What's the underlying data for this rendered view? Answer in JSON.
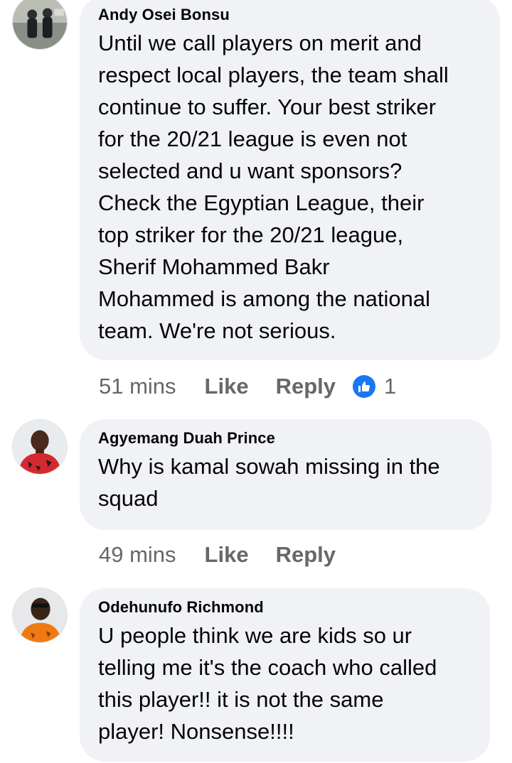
{
  "comments": [
    {
      "author": "Andy Osei Bonsu",
      "text": "Until we call players on merit and\nrespect local players, the team shall\ncontinue to suffer. Your best striker\nfor the 20/21 league is even not\nselected and u want sponsors?\nCheck the Egyptian League, their\ntop striker for the 20/21 league,\nSherif Mohammed Bakr\nMohammed is among the  national\nteam. We're not serious.",
      "time": "51 mins",
      "like_label": "Like",
      "reply_label": "Reply",
      "reaction_icon": "thumbs-up-icon",
      "reaction_count": "1"
    },
    {
      "author": "Agyemang Duah Prince",
      "text": "Why is kamal sowah missing in the\nsquad",
      "time": "49 mins",
      "like_label": "Like",
      "reply_label": "Reply"
    },
    {
      "author": "Odehunufo Richmond",
      "text": "U people think we are kids so ur\ntelling me it's the coach who called\nthis player!!  it is not the same\nplayer! Nonsense!!!!"
    }
  ],
  "colors": {
    "bubble": "#f0f2f5",
    "meta_text": "#65676b",
    "reaction_blue": "#1877f2"
  }
}
